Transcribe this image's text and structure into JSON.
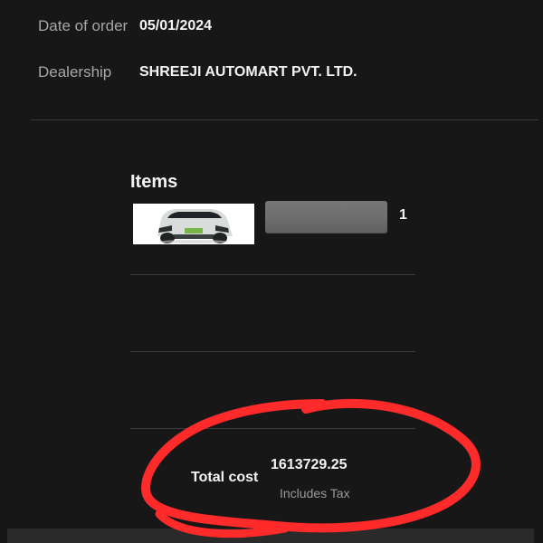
{
  "order": {
    "date_label": "Date of order",
    "date_value": "05/01/2024",
    "dealership_label": "Dealership",
    "dealership_value": "SHREEJI AUTOMART PVT. LTD."
  },
  "items": {
    "title": "Items",
    "list": [
      {
        "image": "car-thumbnail",
        "name_redacted": true,
        "quantity": "1"
      }
    ]
  },
  "summary": {
    "total_label": "Total cost",
    "total_value": "1613729.25",
    "tax_note": "Includes Tax"
  },
  "colors": {
    "background": "#171717",
    "text_primary": "#f4f4f4",
    "text_secondary": "#a7a7a7",
    "divider": "#3a3a3a",
    "annotation": "#ff2a2a"
  }
}
